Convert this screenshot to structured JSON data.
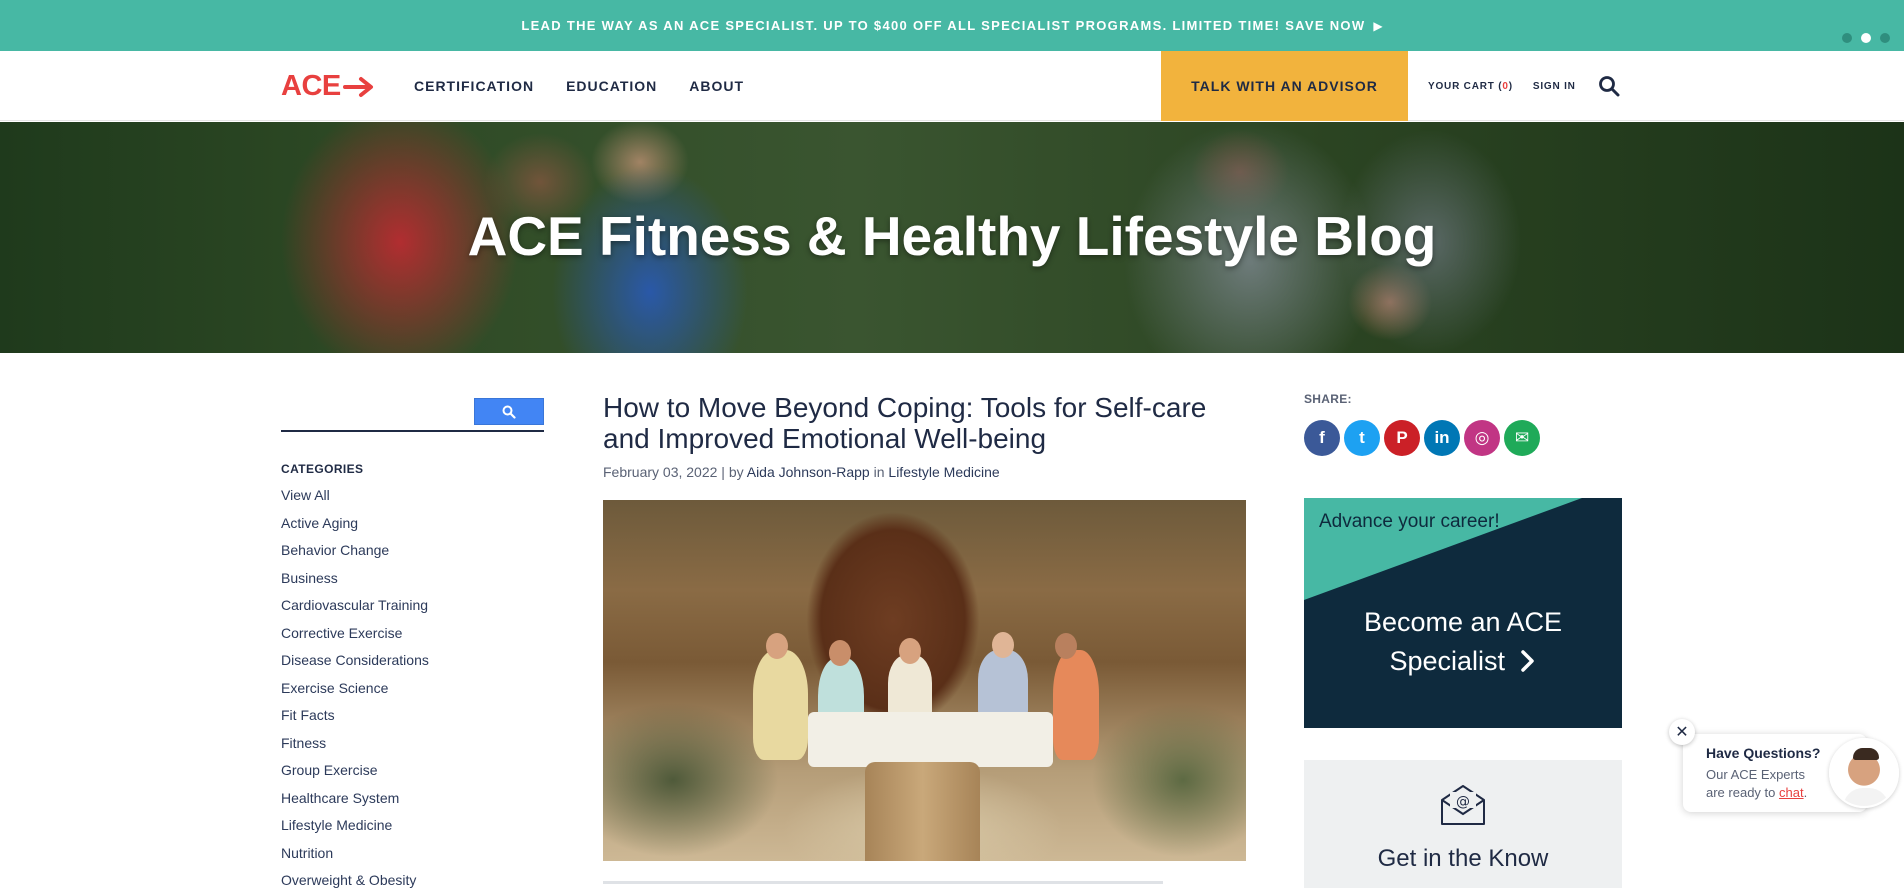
{
  "promo_bar": {
    "text": "LEAD THE WAY AS AN ACE SPECIALIST. UP TO $400 OFF ALL SPECIALIST PROGRAMS. LIMITED TIME! SAVE NOW",
    "arrow": "▶",
    "dots": 3,
    "active_dot": 2
  },
  "nav": {
    "logo_text": "ACE",
    "links": [
      "CERTIFICATION",
      "EDUCATION",
      "ABOUT"
    ],
    "advisor_button": "TALK WITH AN ADVISOR",
    "cart_label": "YOUR CART (",
    "cart_count": "0",
    "cart_close": ")",
    "sign_in": "SIGN IN"
  },
  "hero": {
    "title": "ACE Fitness & Healthy Lifestyle Blog"
  },
  "sidebar": {
    "categories_heading": "CATEGORIES",
    "categories": [
      "View All",
      "Active Aging",
      "Behavior Change",
      "Business",
      "Cardiovascular Training",
      "Corrective Exercise",
      "Disease Considerations",
      "Exercise Science",
      "Fit Facts",
      "Fitness",
      "Group Exercise",
      "Healthcare System",
      "Lifestyle Medicine",
      "Nutrition",
      "Overweight & Obesity"
    ]
  },
  "article": {
    "title": "How to Move Beyond Coping: Tools for Self-care and Improved Emotional Well-being",
    "date": "February 03, 2022",
    "separator": " | by ",
    "author": "Aida Johnson-Rapp",
    "in_text": " in ",
    "category": "Lifestyle Medicine"
  },
  "share": {
    "label": "SHARE:",
    "networks": [
      {
        "name": "facebook-icon",
        "glyph": "f",
        "color": "#3b5998"
      },
      {
        "name": "twitter-icon",
        "glyph": "t",
        "color": "#1da1f2"
      },
      {
        "name": "pinterest-icon",
        "glyph": "P",
        "color": "#cb2027"
      },
      {
        "name": "linkedin-icon",
        "glyph": "in",
        "color": "#0077b5"
      },
      {
        "name": "instagram-icon",
        "glyph": "◎",
        "color": "#c13584"
      },
      {
        "name": "email-icon",
        "glyph": "✉",
        "color": "#1faa59"
      }
    ]
  },
  "promo_card": {
    "advance": "Advance your career!",
    "become_line1": "Become an ACE",
    "become_line2": "Specialist"
  },
  "newsletter": {
    "title": "Get in the Know"
  },
  "chat": {
    "title": "Have Questions?",
    "body": "Our ACE Experts are ready to ",
    "link": "chat",
    "end": "."
  },
  "colors": {
    "teal": "#47b8a4",
    "brand_red": "#e8403f",
    "advisor_yellow": "#f2b33d",
    "navy": "#0e2a3d"
  }
}
